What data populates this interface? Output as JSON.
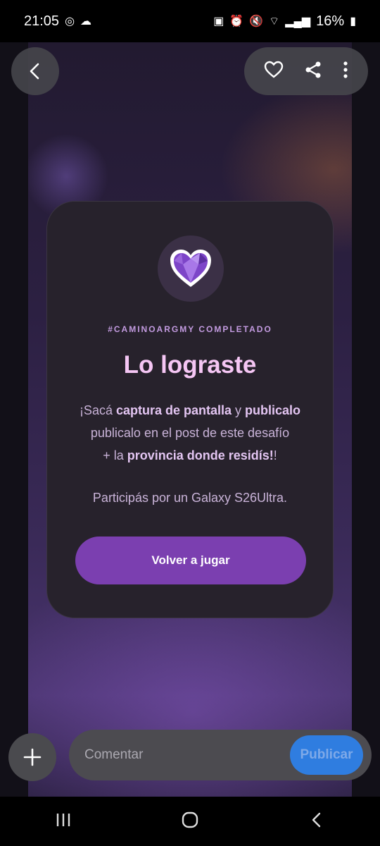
{
  "status_bar": {
    "time": "21:05",
    "battery": "16%",
    "icons": [
      "whatsapp-icon",
      "cloud-icon",
      "battery-saver-icon",
      "alarm-icon",
      "mute-icon",
      "wifi-icon",
      "volte-icon",
      "signal-icon",
      "battery-icon"
    ]
  },
  "top_bar": {
    "back_icon": "back-arrow-icon",
    "actions": [
      "heart-icon",
      "share-icon",
      "more-vertical-icon"
    ]
  },
  "card": {
    "badge_icon": "purple-gem-heart-icon",
    "tag": "#CAMINOARGMY COMPLETADO",
    "title": "Lo lograste",
    "line1_pre": "¡Sacá ",
    "line1_bold1": "captura de pantalla",
    "line1_mid": " y ",
    "line1_bold2": "publicalo",
    "line2": "publicalo en el post de este desafío",
    "line3_pre": "+ la ",
    "line3_bold": "provincia donde residís!",
    "line3_post": "!",
    "participa": "Participás por un Galaxy S26Ultra.",
    "button": "Volver a jugar"
  },
  "comment": {
    "placeholder": "Comentar",
    "publish": "Publicar",
    "add_icon": "plus-icon"
  },
  "colors": {
    "accent": "#7b3fb0",
    "title": "#f5c6f4",
    "publish": "#2f7de0"
  }
}
